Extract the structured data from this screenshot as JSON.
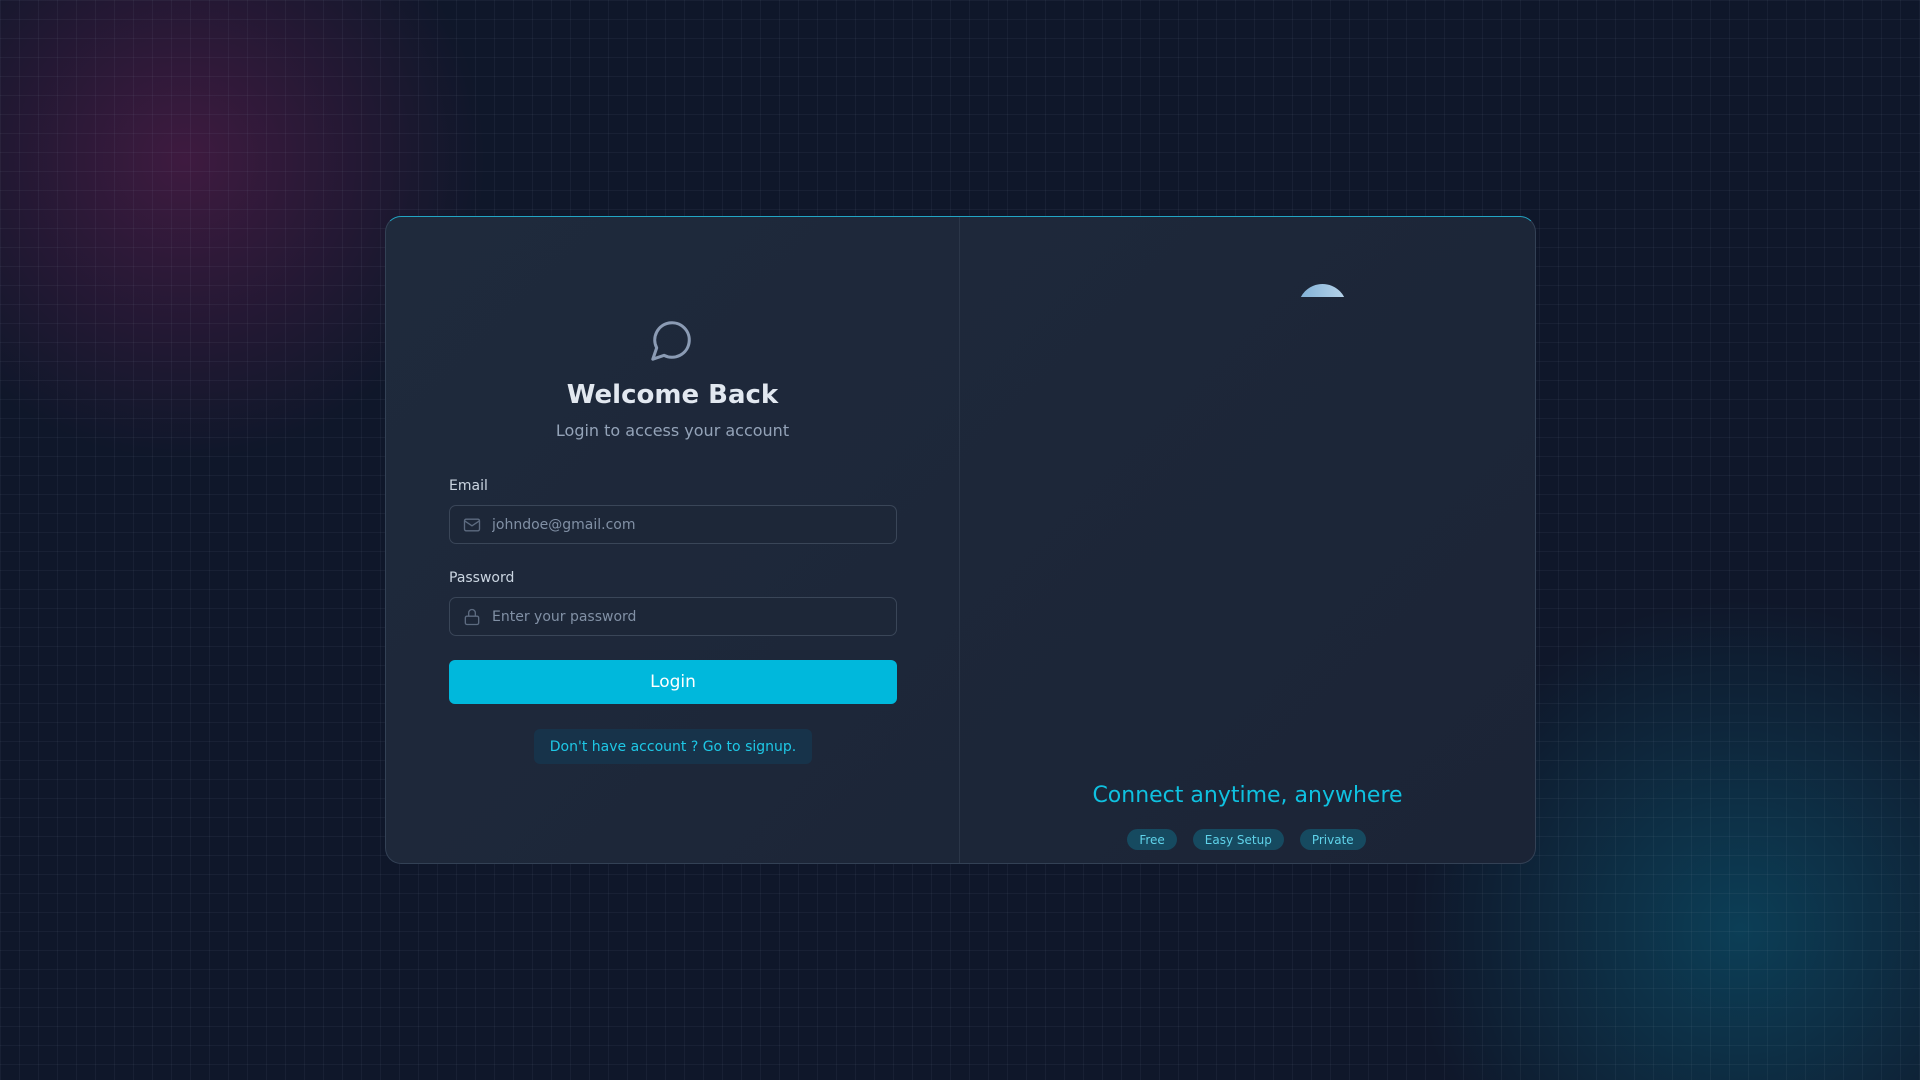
{
  "login": {
    "title": "Welcome Back",
    "subtitle": "Login to access your account",
    "email_label": "Email",
    "email_placeholder": "johndoe@gmail.com",
    "password_label": "Password",
    "password_placeholder": "Enter your password",
    "login_button": "Login",
    "signup_link": "Don't have account ? Go to signup."
  },
  "promo": {
    "tagline": "Connect anytime, anywhere",
    "badges": [
      "Free",
      "Easy Setup",
      "Private"
    ]
  },
  "colors": {
    "accent": "#00b8dc",
    "background": "#0f172a"
  }
}
